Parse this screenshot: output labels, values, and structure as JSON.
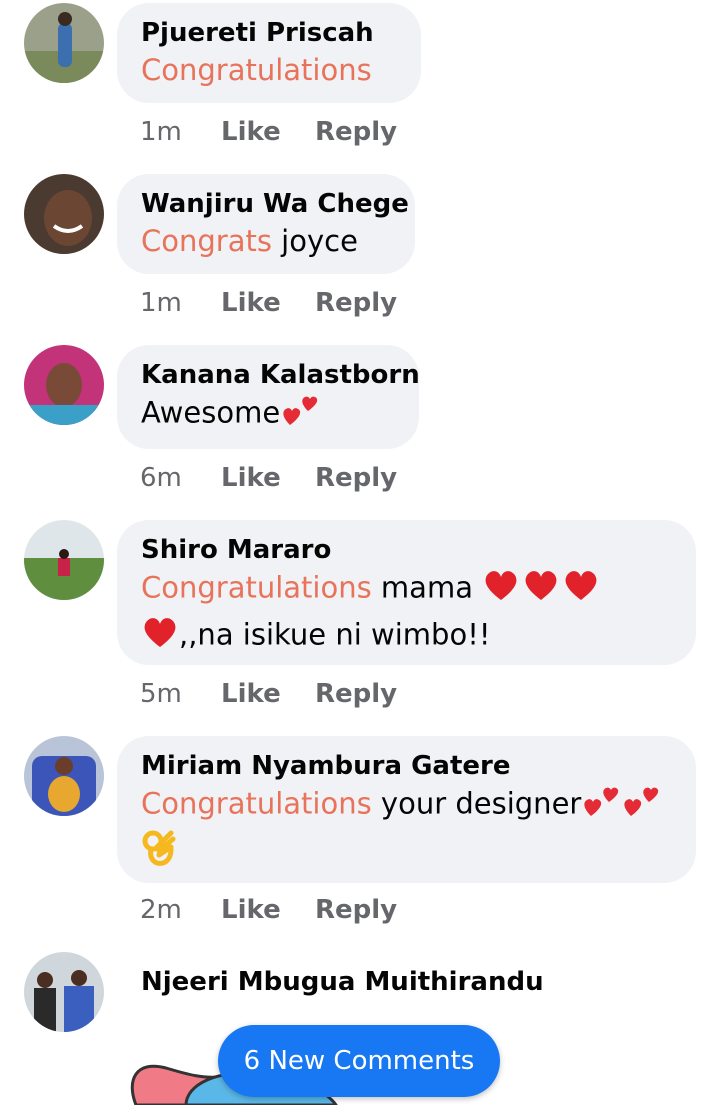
{
  "comments": [
    {
      "author": "Pjuereti Priscah",
      "text_highlight": "Congratulations",
      "text_rest": "",
      "time": "1m",
      "like": "Like",
      "reply": "Reply"
    },
    {
      "author": "Wanjiru Wa Chege",
      "text_highlight": "Congrats",
      "text_rest": " joyce",
      "time": "1m",
      "like": "Like",
      "reply": "Reply"
    },
    {
      "author": "Kanana Kalastborn",
      "text_highlight": "",
      "text_rest": "Awesome",
      "time": "6m",
      "like": "Like",
      "reply": "Reply"
    },
    {
      "author": "Shiro Mararo",
      "text_highlight": "Congratulations",
      "text_rest": " mama ",
      "text_line2": ",,na isikue ni wimbo!!",
      "time": "5m",
      "like": "Like",
      "reply": "Reply"
    },
    {
      "author": "Miriam Nyambura Gatere",
      "text_highlight": "Congratulations",
      "text_rest": " your designer",
      "time": "2m",
      "like": "Like",
      "reply": "Reply"
    },
    {
      "author": "Njeeri Mbugua Muithirandu"
    }
  ],
  "new_comments_button": {
    "label": "6 New Comments"
  },
  "colors": {
    "highlight": "#e8735a",
    "bubble": "#f0f2f5",
    "meta": "#65676b",
    "accent": "#1877f2"
  }
}
